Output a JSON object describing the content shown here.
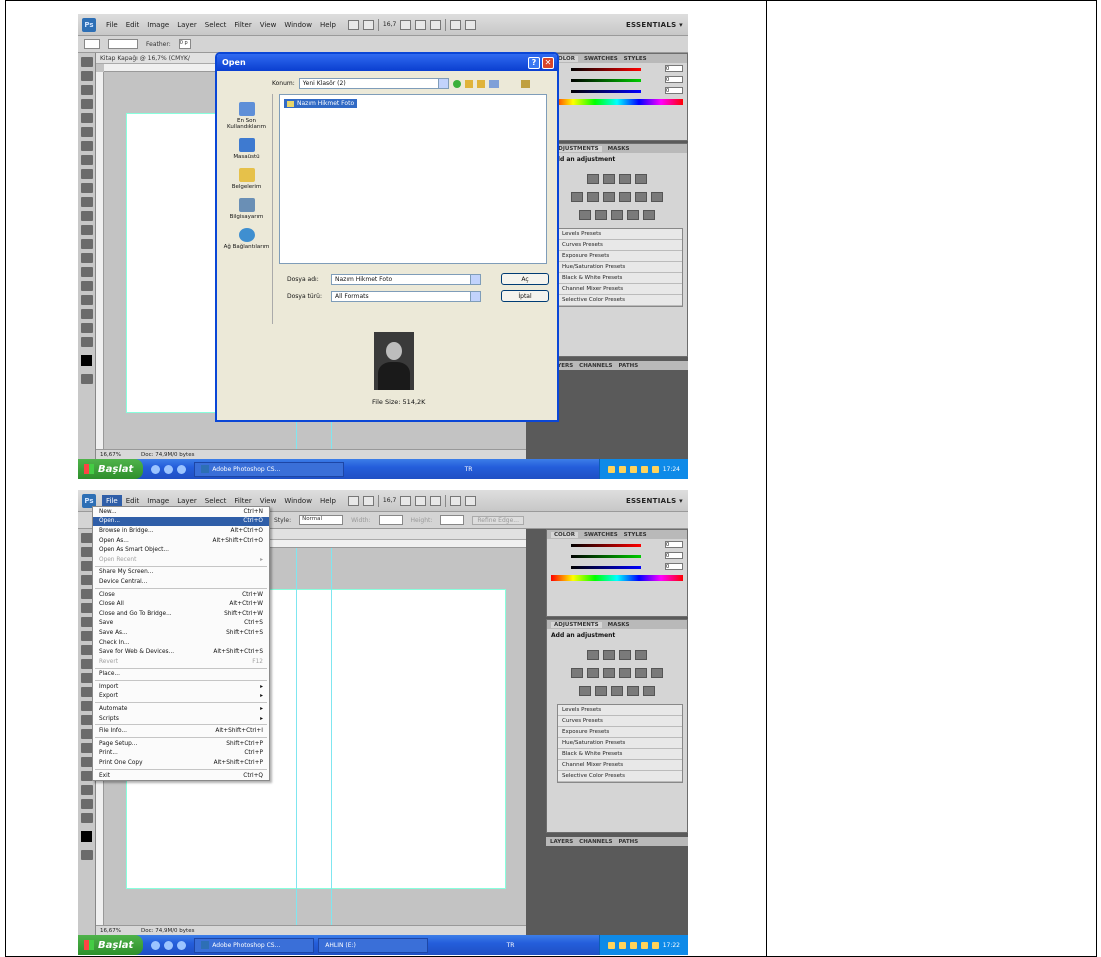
{
  "shot1": {
    "menubar": {
      "items": [
        "File",
        "Edit",
        "Image",
        "Layer",
        "Select",
        "Filter",
        "View",
        "Window",
        "Help"
      ],
      "zoom": "16,7",
      "workspace": "ESSENTIALS ▾"
    },
    "options": {
      "feather_label": "Feather:",
      "feather_value": "0 p"
    },
    "doc_tab": "Kitap Kapağı @ 16,7% (CMYK/",
    "status": {
      "zoom": "16,67%",
      "doc": "Doc: 74,9M/0 bytes"
    },
    "dialog": {
      "title": "Open",
      "look_in_label": "Konum:",
      "look_in_value": "Yeni Klasör (2)",
      "places": [
        "En Son Kullandıklarım",
        "Masaüstü",
        "Belgelerim",
        "Bilgisayarım",
        "Ağ Bağlantılarım"
      ],
      "file_item": "Nazım Hikmet Foto",
      "filename_label": "Dosya adı:",
      "filename_value": "Nazım Hikmet Foto",
      "filetype_label": "Dosya türü:",
      "filetype_value": "All Formats",
      "open_button": "Aç",
      "cancel_button": "İptal",
      "file_size": "File Size: 514,2K"
    },
    "panels": {
      "color_tabs": [
        "COLOR",
        "SWATCHES",
        "STYLES"
      ],
      "color_values": {
        "r": "0",
        "g": "0",
        "b": "0"
      },
      "adj_tabs": [
        "ADJUSTMENTS",
        "MASKS"
      ],
      "adj_title": "Add an adjustment",
      "presets": [
        "Levels Presets",
        "Curves Presets",
        "Exposure Presets",
        "Hue/Saturation Presets",
        "Black & White Presets",
        "Channel Mixer Presets",
        "Selective Color Presets"
      ],
      "layers_tabs": [
        "LAYERS",
        "CHANNELS",
        "PATHS"
      ]
    },
    "taskbar": {
      "start": "Başlat",
      "task1": "Adobe Photoshop CS...",
      "lang": "TR",
      "time": "17:24"
    }
  },
  "shot2": {
    "menubar": {
      "items": [
        "File",
        "Edit",
        "Image",
        "Layer",
        "Select",
        "Filter",
        "View",
        "Window",
        "Help"
      ],
      "zoom": "16,7",
      "workspace": "ESSENTIALS ▾"
    },
    "options": {
      "style_label": "Style:",
      "style_value": "Normal",
      "width_label": "Width:",
      "height_label": "Height:",
      "refine_label": "Refine Edge..."
    },
    "status": {
      "zoom": "16,67%",
      "doc": "Doc: 74,9M/0 bytes"
    },
    "file_menu": [
      {
        "label": "New...",
        "shortcut": "Ctrl+N"
      },
      {
        "label": "Open...",
        "shortcut": "Ctrl+O",
        "hl": true
      },
      {
        "label": "Browse in Bridge...",
        "shortcut": "Alt+Ctrl+O"
      },
      {
        "label": "Open As...",
        "shortcut": "Alt+Shift+Ctrl+O"
      },
      {
        "label": "Open As Smart Object...",
        "shortcut": ""
      },
      {
        "label": "Open Recent",
        "shortcut": "▸",
        "dis": true
      },
      {
        "sep": true
      },
      {
        "label": "Share My Screen...",
        "shortcut": ""
      },
      {
        "label": "Device Central...",
        "shortcut": ""
      },
      {
        "sep": true
      },
      {
        "label": "Close",
        "shortcut": "Ctrl+W"
      },
      {
        "label": "Close All",
        "shortcut": "Alt+Ctrl+W"
      },
      {
        "label": "Close and Go To Bridge...",
        "shortcut": "Shift+Ctrl+W"
      },
      {
        "label": "Save",
        "shortcut": "Ctrl+S"
      },
      {
        "label": "Save As...",
        "shortcut": "Shift+Ctrl+S"
      },
      {
        "label": "Check In...",
        "shortcut": ""
      },
      {
        "label": "Save for Web & Devices...",
        "shortcut": "Alt+Shift+Ctrl+S"
      },
      {
        "label": "Revert",
        "shortcut": "F12",
        "dis": true
      },
      {
        "sep": true
      },
      {
        "label": "Place...",
        "shortcut": ""
      },
      {
        "sep": true
      },
      {
        "label": "Import",
        "shortcut": "▸"
      },
      {
        "label": "Export",
        "shortcut": "▸"
      },
      {
        "sep": true
      },
      {
        "label": "Automate",
        "shortcut": "▸"
      },
      {
        "label": "Scripts",
        "shortcut": "▸"
      },
      {
        "sep": true
      },
      {
        "label": "File Info...",
        "shortcut": "Alt+Shift+Ctrl+I"
      },
      {
        "sep": true
      },
      {
        "label": "Page Setup...",
        "shortcut": "Shift+Ctrl+P"
      },
      {
        "label": "Print...",
        "shortcut": "Ctrl+P"
      },
      {
        "label": "Print One Copy",
        "shortcut": "Alt+Shift+Ctrl+P"
      },
      {
        "sep": true
      },
      {
        "label": "Exit",
        "shortcut": "Ctrl+Q"
      }
    ],
    "panels": {
      "color_tabs": [
        "COLOR",
        "SWATCHES",
        "STYLES"
      ],
      "color_values": {
        "r": "0",
        "g": "0",
        "b": "0"
      },
      "adj_tabs": [
        "ADJUSTMENTS",
        "MASKS"
      ],
      "adj_title": "Add an adjustment",
      "presets": [
        "Levels Presets",
        "Curves Presets",
        "Exposure Presets",
        "Hue/Saturation Presets",
        "Black & White Presets",
        "Channel Mixer Presets",
        "Selective Color Presets"
      ],
      "layers_tabs": [
        "LAYERS",
        "CHANNELS",
        "PATHS"
      ]
    },
    "taskbar": {
      "start": "Başlat",
      "task1": "Adobe Photoshop CS...",
      "task2": "AHLIN (E:)",
      "lang": "TR",
      "time": "17:22"
    }
  }
}
